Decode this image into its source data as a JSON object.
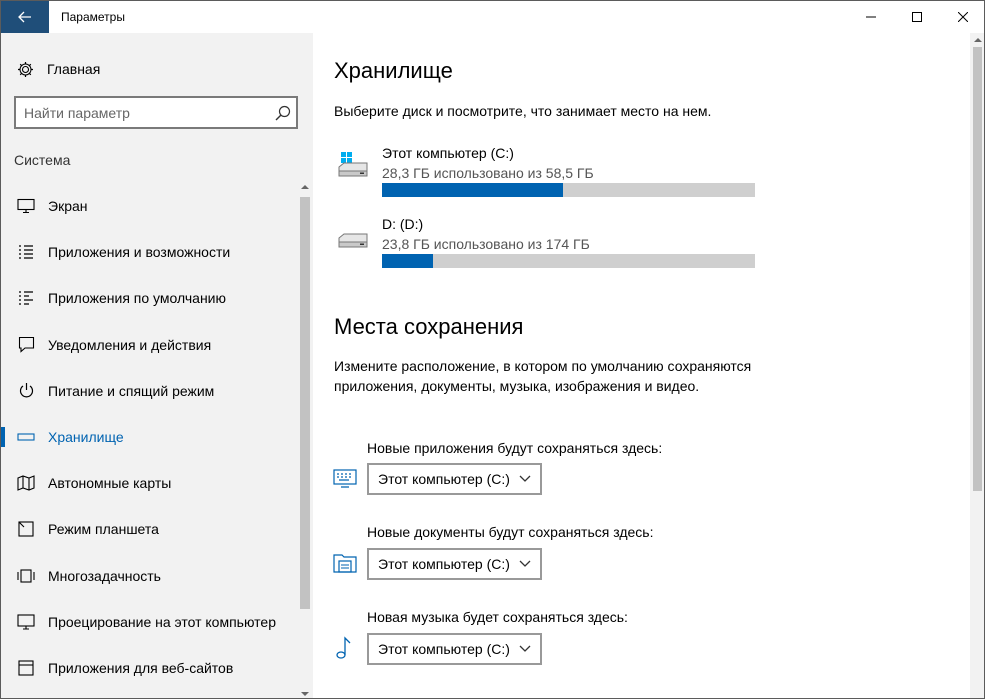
{
  "window": {
    "title": "Параметры"
  },
  "sidebar": {
    "home_label": "Главная",
    "search_placeholder": "Найти параметр",
    "section_label": "Система",
    "items": [
      {
        "label": "Экран",
        "icon": "monitor-icon"
      },
      {
        "label": "Приложения и возможности",
        "icon": "apps-list-icon"
      },
      {
        "label": "Приложения по умолчанию",
        "icon": "default-apps-icon"
      },
      {
        "label": "Уведомления и действия",
        "icon": "notification-icon"
      },
      {
        "label": "Питание и спящий режим",
        "icon": "power-icon"
      },
      {
        "label": "Хранилище",
        "icon": "storage-drive-icon",
        "active": true
      },
      {
        "label": "Автономные карты",
        "icon": "map-icon"
      },
      {
        "label": "Режим планшета",
        "icon": "tablet-icon"
      },
      {
        "label": "Многозадачность",
        "icon": "multitasking-icon"
      },
      {
        "label": "Проецирование на этот компьютер",
        "icon": "projection-icon"
      },
      {
        "label": "Приложения для веб-сайтов",
        "icon": "web-apps-icon"
      }
    ]
  },
  "main": {
    "title": "Хранилище",
    "description": "Выберите диск и посмотрите, что занимает место на нем.",
    "drives": [
      {
        "name": "Этот компьютер (C:)",
        "usage": "28,3 ГБ использовано из 58,5 ГБ",
        "used_fraction": 0.484,
        "icon": "windows-drive-icon"
      },
      {
        "name": "D: (D:)",
        "usage": "23,8 ГБ использовано из 174 ГБ",
        "used_fraction": 0.137,
        "icon": "hard-drive-icon"
      }
    ],
    "save_locations": {
      "title": "Места сохранения",
      "description": "Измените расположение, в котором по умолчанию сохраняются приложения, документы, музыка, изображения и видео.",
      "items": [
        {
          "label": "Новые приложения будут сохраняться здесь:",
          "value": "Этот компьютер (C:)",
          "icon": "apps-monitor-icon"
        },
        {
          "label": "Новые документы будут сохраняться здесь:",
          "value": "Этот компьютер (C:)",
          "icon": "documents-folder-icon"
        },
        {
          "label": "Новая музыка будет сохраняться здесь:",
          "value": "Этот компьютер (C:)",
          "icon": "music-note-icon"
        }
      ]
    }
  },
  "colors": {
    "accent": "#0063b1",
    "titlebar_back": "#1f4e79",
    "sidebar_bg": "#f2f2f2",
    "bar_track": "#cfcfcf"
  }
}
